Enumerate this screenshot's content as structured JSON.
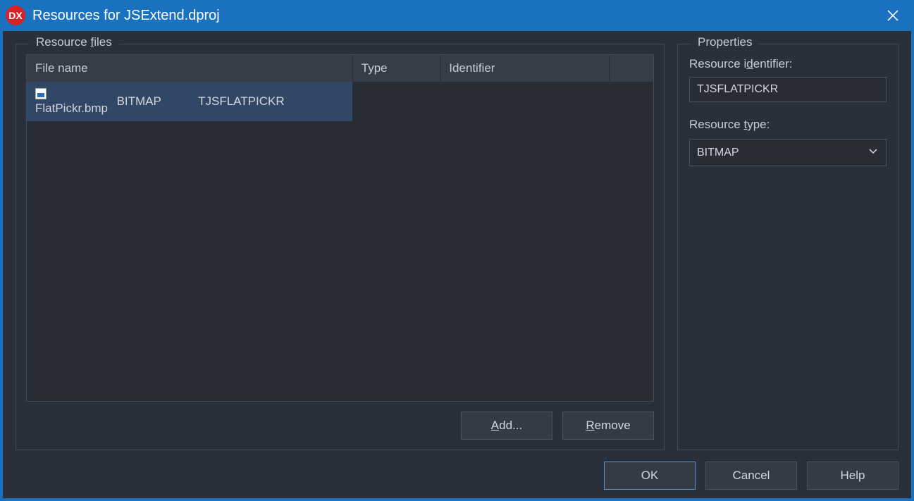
{
  "titlebar": {
    "logo_text": "DX",
    "title": "Resources for JSExtend.dproj"
  },
  "resource_files": {
    "legend": "Resource files",
    "legend_u_index": 9,
    "columns": {
      "file_name": "File name",
      "type": "Type",
      "identifier": "Identifier"
    },
    "rows": [
      {
        "file_name": "FlatPickr.bmp",
        "type": "BITMAP",
        "identifier": "TJSFLATPICKR",
        "selected": true
      }
    ],
    "buttons": {
      "add": "Add...",
      "remove": "Remove"
    }
  },
  "properties": {
    "legend": "Properties",
    "identifier_label": "Resource identifier:",
    "identifier_value": "TJSFLATPICKR",
    "type_label": "Resource type:",
    "type_value": "BITMAP"
  },
  "footer": {
    "ok": "OK",
    "cancel": "Cancel",
    "help": "Help"
  }
}
